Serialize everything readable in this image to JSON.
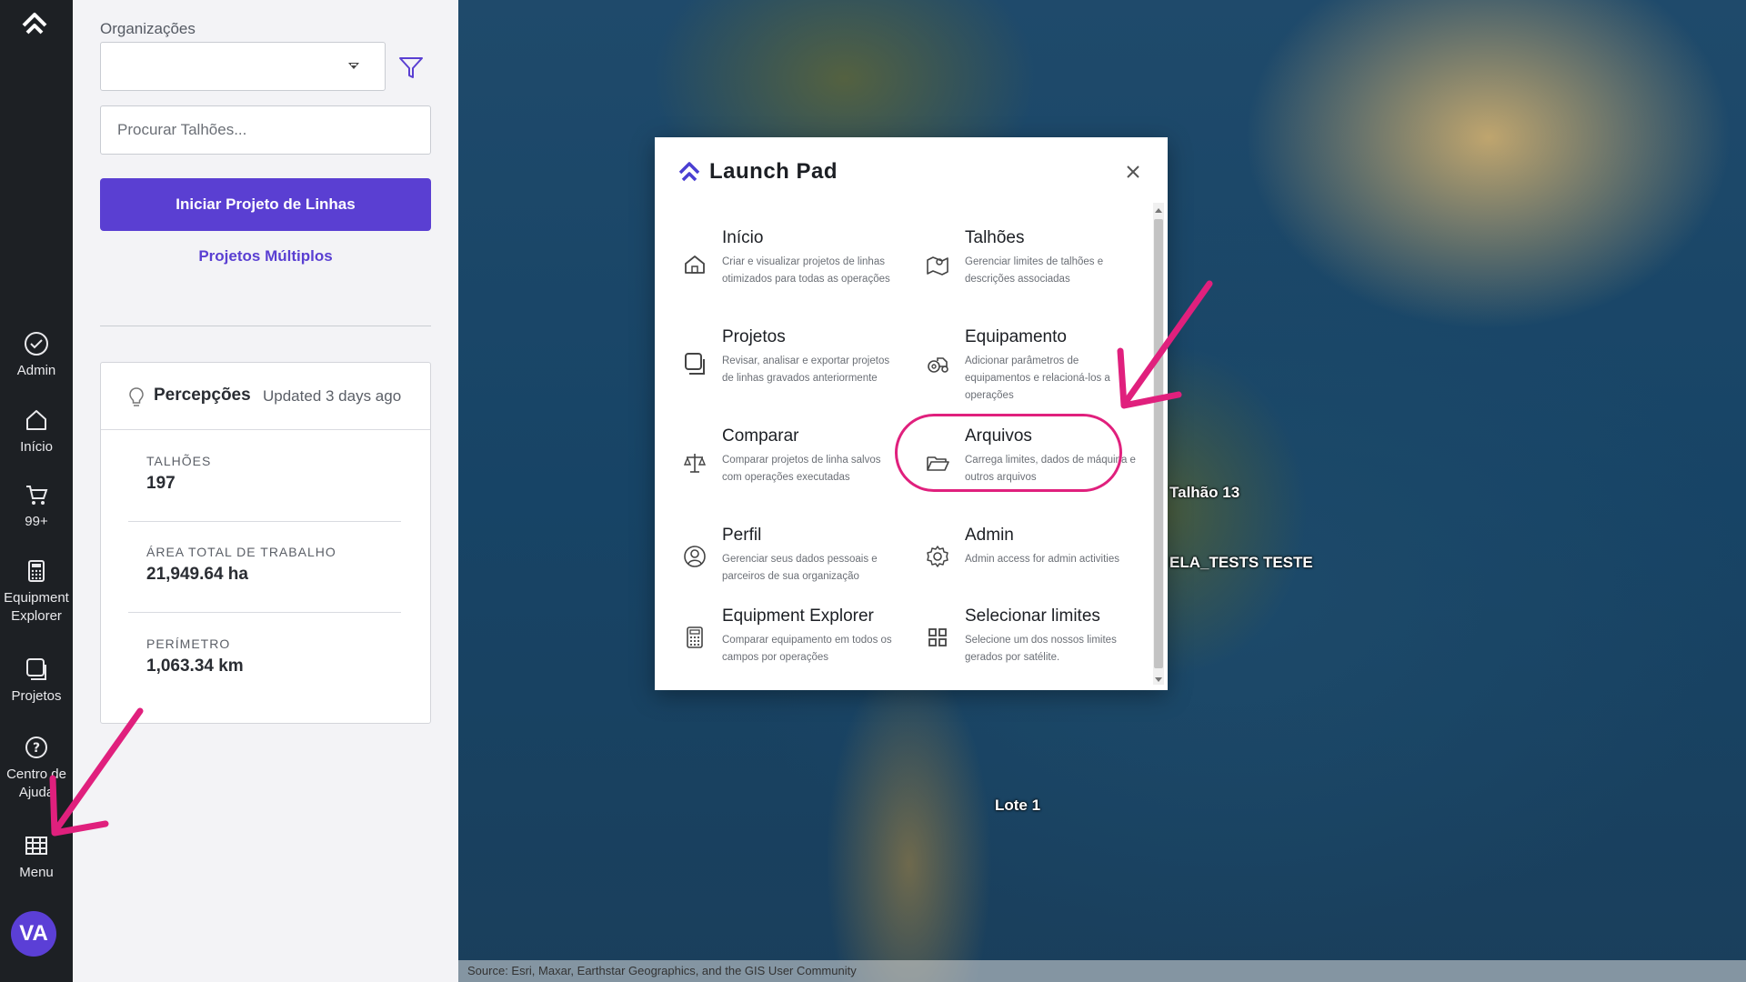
{
  "rail": {
    "items": [
      {
        "label": "Admin",
        "icon": "check-circle-icon"
      },
      {
        "label": "Início",
        "icon": "home-icon"
      },
      {
        "label": "99+",
        "icon": "cart-icon"
      },
      {
        "label": "Equipment Explorer",
        "icon": "calculator-icon"
      },
      {
        "label": "Projetos",
        "icon": "projects-icon"
      },
      {
        "label": "Centro de Ajuda",
        "icon": "help-icon"
      },
      {
        "label": "Menu",
        "icon": "grid-icon"
      }
    ],
    "avatar": "VA"
  },
  "panel": {
    "org_label": "Organizações",
    "org_value": "",
    "search_placeholder": "Procurar Talhões...",
    "primary_button": "Iniciar Projeto de Linhas",
    "multi_link": "Projetos Múltiplos",
    "insights": {
      "title": "Percepções",
      "updated": "Updated 3 days ago",
      "stats": [
        {
          "label": "TALHÕES",
          "value": "197"
        },
        {
          "label": "ÁREA TOTAL DE TRABALHO",
          "value": "21,949.64 ha"
        },
        {
          "label": "PERÍMETRO",
          "value": "1,063.34 km"
        }
      ]
    }
  },
  "map": {
    "labels": [
      "Talhão 13",
      "ELA_TESTS TESTE",
      "Lote 1"
    ],
    "attribution": "Source: Esri, Maxar, Earthstar Geographics, and the GIS User Community"
  },
  "launchpad": {
    "title": "Launch Pad",
    "items": [
      {
        "title": "Início",
        "desc": "Criar e visualizar projetos de linhas otimizados para todas as operações",
        "icon": "home-icon"
      },
      {
        "title": "Talhões",
        "desc": "Gerenciar limites de talhões e descrições associadas",
        "icon": "map-icon"
      },
      {
        "title": "Projetos",
        "desc": "Revisar, analisar e exportar projetos de linhas gravados anteriormente",
        "icon": "projects-icon"
      },
      {
        "title": "Equipamento",
        "desc": "Adicionar parâmetros de equipamentos e relacioná-los a operações",
        "icon": "tractor-icon"
      },
      {
        "title": "Comparar",
        "desc": "Comparar projetos de linha salvos com operações executadas",
        "icon": "scale-icon"
      },
      {
        "title": "Arquivos",
        "desc": "Carrega limites, dados de máquina e outros arquivos",
        "icon": "folder-icon"
      },
      {
        "title": "Perfil",
        "desc": "Gerenciar seus dados pessoais e parceiros de sua organização",
        "icon": "user-icon"
      },
      {
        "title": "Admin",
        "desc": "Admin access for admin activities",
        "icon": "gear-icon"
      },
      {
        "title": "Equipment Explorer",
        "desc": "Comparar equipamento em todos os campos por operações",
        "icon": "calculator-icon"
      },
      {
        "title": "Selecionar limites",
        "desc": "Selecione um dos nossos limites gerados por satélite.",
        "icon": "grid-icon"
      }
    ]
  },
  "colors": {
    "accent": "#5a3fd2",
    "highlight": "#e0207d",
    "rail": "#1d2024"
  }
}
